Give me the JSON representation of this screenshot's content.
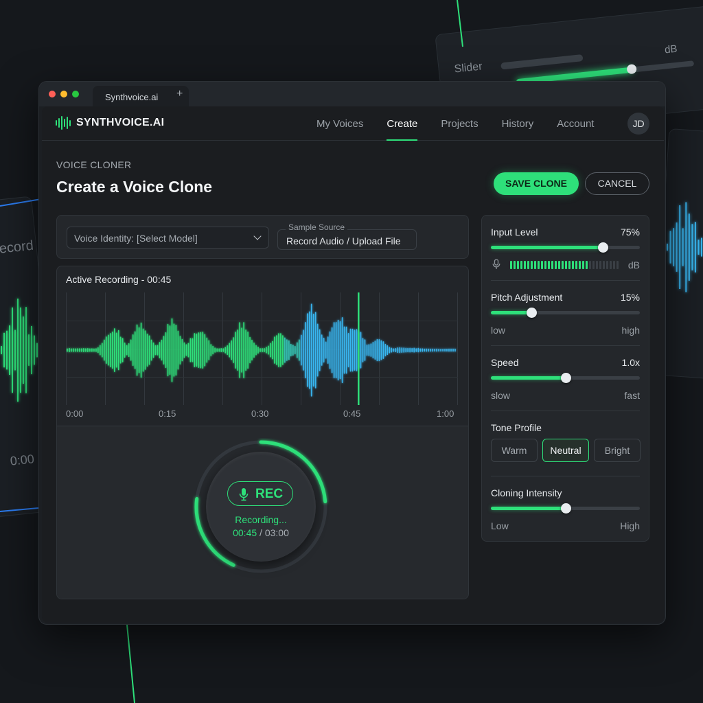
{
  "background": {
    "slider_label": "Slider",
    "slider_unit": "dB",
    "left_label": "Record",
    "left_time": "0:00"
  },
  "browser": {
    "tab_title": "Synthvoice.ai",
    "new_tab": "+"
  },
  "app": {
    "brand": "SYNTHVOICE.AI",
    "nav": [
      "My Voices",
      "Create",
      "Projects",
      "History",
      "Account"
    ],
    "active_nav": "Create",
    "avatar_initials": "JD"
  },
  "page": {
    "eyebrow": "VOICE CLONER",
    "title": "Create a Voice Clone",
    "save_label": "SAVE CLONE",
    "cancel_label": "CANCEL"
  },
  "selectors": {
    "voice_identity": "Voice Identity: [Select Model]",
    "sample_source_label": "Sample Source",
    "sample_source_value": "Record Audio / Upload File"
  },
  "recording": {
    "title": "Active Recording - 00:45",
    "time_ticks": [
      "0:00",
      "0:15",
      "0:30",
      "0:45",
      "1:00"
    ],
    "playhead_fraction": 0.75,
    "rec_label": "REC",
    "status": "Recording...",
    "current_time": "00:45",
    "time_separator": " / ",
    "total_time": "03:00",
    "progress_fraction": 0.25
  },
  "controls": {
    "input_level": {
      "title": "Input Level",
      "value": "75%",
      "fraction": 0.75,
      "unit": "dB",
      "meter_fraction": 0.72
    },
    "pitch": {
      "title": "Pitch Adjustment",
      "value": "15%",
      "fraction": 0.27,
      "low": "low",
      "high": "high"
    },
    "speed": {
      "title": "Speed",
      "value": "1.0x",
      "fraction": 0.5,
      "low": "slow",
      "high": "fast"
    },
    "tone": {
      "title": "Tone Profile",
      "options": [
        "Warm",
        "Neutral",
        "Bright"
      ],
      "selected": "Neutral"
    },
    "intensity": {
      "title": "Cloning Intensity",
      "fraction": 0.5,
      "low": "Low",
      "high": "High"
    }
  },
  "colors": {
    "accent": "#2ee07a",
    "wave_blue": "#39b6f0",
    "bg": "#15181c"
  }
}
